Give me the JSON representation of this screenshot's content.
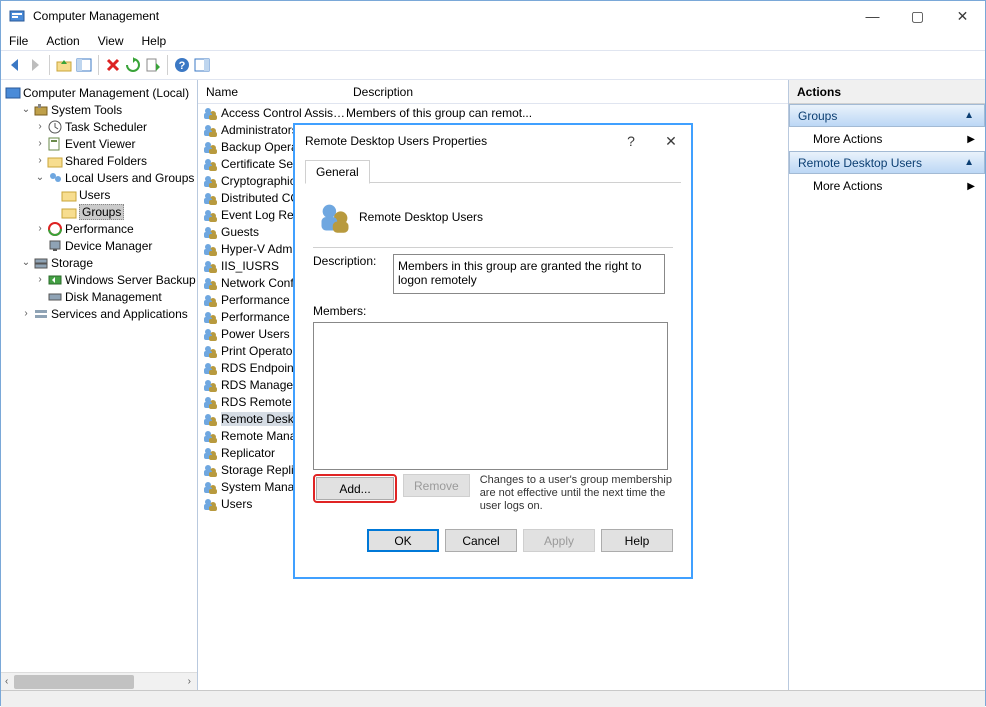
{
  "window": {
    "title": "Computer Management"
  },
  "window_controls": {
    "min": "—",
    "max": "▢",
    "close": "✕"
  },
  "menu": {
    "file": "File",
    "action": "Action",
    "view": "View",
    "help": "Help"
  },
  "tree": {
    "root": "Computer Management (Local)",
    "system_tools": "System Tools",
    "task_scheduler": "Task Scheduler",
    "event_viewer": "Event Viewer",
    "shared_folders": "Shared Folders",
    "local_users": "Local Users and Groups",
    "users": "Users",
    "groups": "Groups",
    "performance": "Performance",
    "device_manager": "Device Manager",
    "storage": "Storage",
    "server_backup": "Windows Server Backup",
    "disk_mgmt": "Disk Management",
    "services_apps": "Services and Applications"
  },
  "list": {
    "col_name": "Name",
    "col_desc": "Description",
    "items": [
      {
        "name": "Access Control Assist...",
        "desc": "Members of this group can remot..."
      },
      {
        "name": "Administrators",
        "desc": ""
      },
      {
        "name": "Backup Operators",
        "desc": ""
      },
      {
        "name": "Certificate Service DCOM Access",
        "desc": ""
      },
      {
        "name": "Cryptographic Operators",
        "desc": ""
      },
      {
        "name": "Distributed COM Users",
        "desc": ""
      },
      {
        "name": "Event Log Readers",
        "desc": ""
      },
      {
        "name": "Guests",
        "desc": ""
      },
      {
        "name": "Hyper-V Administrators",
        "desc": ""
      },
      {
        "name": "IIS_IUSRS",
        "desc": ""
      },
      {
        "name": "Network Configuration Operators",
        "desc": ""
      },
      {
        "name": "Performance Log Users",
        "desc": ""
      },
      {
        "name": "Performance Monitor Users",
        "desc": ""
      },
      {
        "name": "Power Users",
        "desc": ""
      },
      {
        "name": "Print Operators",
        "desc": ""
      },
      {
        "name": "RDS Endpoint Servers",
        "desc": ""
      },
      {
        "name": "RDS Management Servers",
        "desc": ""
      },
      {
        "name": "RDS Remote Access Servers",
        "desc": ""
      },
      {
        "name": "Remote Desktop Users",
        "desc": ""
      },
      {
        "name": "Remote Management Users",
        "desc": ""
      },
      {
        "name": "Replicator",
        "desc": ""
      },
      {
        "name": "Storage Replica Administrators",
        "desc": ""
      },
      {
        "name": "System Managed Accounts Group",
        "desc": ""
      },
      {
        "name": "Users",
        "desc": ""
      }
    ],
    "selected": 18
  },
  "actions": {
    "header": "Actions",
    "groups_label": "Groups",
    "more1": "More Actions",
    "rdu_label": "Remote Desktop Users",
    "more2": "More Actions"
  },
  "dialog": {
    "title": "Remote Desktop Users Properties",
    "tab_general": "General",
    "group_name": "Remote Desktop Users",
    "desc_label": "Description:",
    "desc_value": "Members in this group are granted the right to logon remotely",
    "members_label": "Members:",
    "add": "Add...",
    "remove": "Remove",
    "note": "Changes to a user's group membership are not effective until the next time the user logs on.",
    "ok": "OK",
    "cancel": "Cancel",
    "apply": "Apply",
    "help": "Help"
  }
}
